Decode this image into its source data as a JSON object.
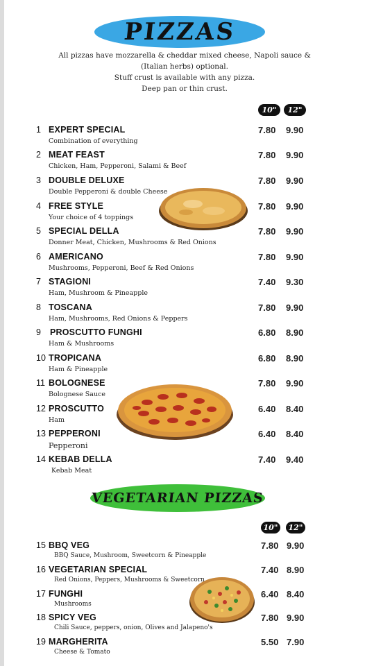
{
  "title": "PIZZAS",
  "intro": [
    "All pizzas have mozzarella & cheddar mixed cheese, Napoli sauce &",
    "(Italian herbs) optional.",
    "Stuff crust is available with any pizza.",
    "Deep pan or thin crust."
  ],
  "sizes": {
    "small": "10\"",
    "large": "12\""
  },
  "pizzas": [
    {
      "num": "1",
      "name": "EXPERT SPECIAL",
      "desc": "Combination of everything",
      "p10": "7.80",
      "p12": "9.90"
    },
    {
      "num": "2",
      "name": "MEAT FEAST",
      "desc": "Chicken, Ham, Pepperoni, Salami & Beef",
      "p10": "7.80",
      "p12": "9.90"
    },
    {
      "num": "3",
      "name": "DOUBLE DELUXE",
      "desc": "Double Pepperoni & double Cheese",
      "p10": "7.80",
      "p12": "9.90"
    },
    {
      "num": "4",
      "name": "FREE STYLE",
      "desc": "Your choice of 4 toppings",
      "p10": "7.80",
      "p12": "9.90"
    },
    {
      "num": "5",
      "name": "SPECIAL DELLA",
      "desc": "Donner Meat, Chicken, Mushrooms & Red Onions",
      "p10": "7.80",
      "p12": "9.90"
    },
    {
      "num": "6",
      "name": "AMERICANO",
      "desc": "Mushrooms, Pepperoni, Beef & Red Onions",
      "p10": "7.80",
      "p12": "9.90"
    },
    {
      "num": "7",
      "name": "STAGIONI",
      "desc": "Ham, Mushroom & Pineapple",
      "p10": "7.40",
      "p12": "9.30"
    },
    {
      "num": "8",
      "name": "TOSCANA",
      "desc": "Ham, Mushrooms, Red Onions & Peppers",
      "p10": "7.80",
      "p12": "9.90"
    },
    {
      "num": "9",
      "name": "PROSCUTTO FUNGHI",
      "desc": "Ham & Mushrooms",
      "p10": "6.80",
      "p12": "8.90"
    },
    {
      "num": "10",
      "name": "TROPICANA",
      "desc": "Ham & Pineapple",
      "p10": "6.80",
      "p12": "8.90"
    },
    {
      "num": "11",
      "name": "BOLOGNESE",
      "desc": "Bolognese Sauce",
      "p10": "7.80",
      "p12": "9.90"
    },
    {
      "num": "12",
      "name": "PROSCUTTO",
      "desc": "Ham",
      "p10": "6.40",
      "p12": "8.40"
    },
    {
      "num": "13",
      "name": "PEPPERONI",
      "desc": "Pepperoni",
      "p10": "6.40",
      "p12": "8.40"
    },
    {
      "num": "14",
      "name": "KEBAB DELLA",
      "desc": "Kebab Meat",
      "p10": "7.40",
      "p12": "9.40"
    }
  ],
  "veg_title": "VEGETARIAN PIZZAS",
  "veg_pizzas": [
    {
      "num": "15",
      "name": "BBQ VEG",
      "desc": "BBQ Sauce, Mushroom, Sweetcorn & Pineapple",
      "p10": "7.80",
      "p12": "9.90"
    },
    {
      "num": "16",
      "name": "VEGETARIAN SPECIAL",
      "desc": "Red Onions, Peppers, Mushrooms & Sweetcorn",
      "p10": "7.40",
      "p12": "8.90"
    },
    {
      "num": "17",
      "name": "FUNGHI",
      "desc": "Mushrooms",
      "p10": "6.40",
      "p12": "8.40"
    },
    {
      "num": "18",
      "name": "SPICY VEG",
      "desc": "Chili Sauce, peppers, onion, Olives and Jalapeno's",
      "p10": "7.80",
      "p12": "9.90"
    },
    {
      "num": "19",
      "name": "MARGHERITA",
      "desc": "Cheese & Tomato",
      "p10": "5.50",
      "p12": "7.90"
    }
  ],
  "colors": {
    "title_oval": "#3aa7e4",
    "veg_oval": "#3fbf3a",
    "pill": "#111111"
  }
}
